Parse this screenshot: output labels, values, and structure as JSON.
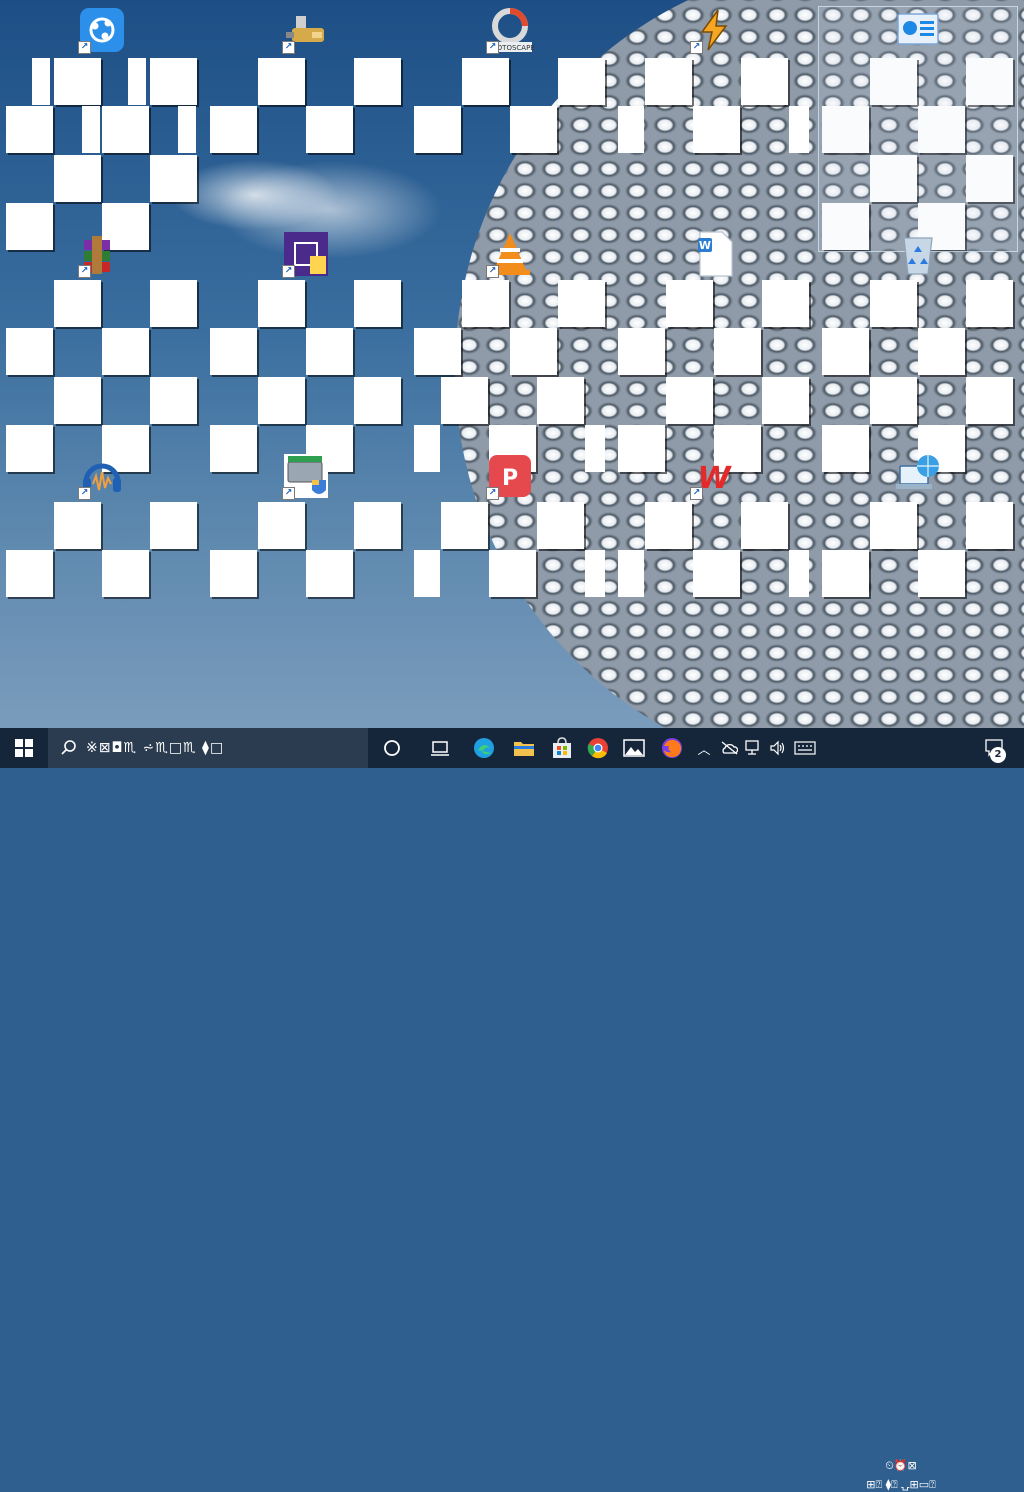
{
  "desktop": {
    "icons": [
      {
        "name": "shareit-icon",
        "color": "#2c8fea"
      },
      {
        "name": "usb-cable-icon",
        "color": "#d6a94a"
      },
      {
        "name": "gotoscape-icon",
        "color": "#e24a2e",
        "label": "GOTOSCAPE"
      },
      {
        "name": "lightning-app-icon",
        "color": "#f5a623"
      },
      {
        "name": "control-panel-icon",
        "color": "#1e88e5"
      },
      {
        "name": "winrar-icon",
        "color": "#7b2fa6"
      },
      {
        "name": "cpu-z-icon",
        "color": "#4a2a8a"
      },
      {
        "name": "vlc-icon",
        "color": "#f28c1a"
      },
      {
        "name": "word-document-icon",
        "color": "#2b7cd3",
        "label": "W"
      },
      {
        "name": "recycle-bin-icon",
        "color": "#c7d7e6"
      },
      {
        "name": "audacity-icon",
        "color": "#1f5fb4"
      },
      {
        "name": "disk-cleanup-icon",
        "color": "#9aa6b2"
      },
      {
        "name": "wps-presentation-icon",
        "color": "#e5484d",
        "label": "P"
      },
      {
        "name": "wps-office-icon",
        "color": "#e4292a",
        "label": "W"
      },
      {
        "name": "network-computer-icon",
        "color": "#3aa0e6"
      }
    ]
  },
  "taskbar": {
    "search_text": "※⊠◘♏  ⩫♏□♏  ⧫□",
    "clock_time": "⏲⏰⊠",
    "clock_date": "⊞⍰ ⧫⍰ ⍽⊞▭⍰",
    "notification_count": "2",
    "pinned": [
      {
        "name": "edge-icon",
        "color": "#1fa0e0"
      },
      {
        "name": "file-explorer-icon",
        "color": "#f2c14e"
      },
      {
        "name": "microsoft-store-icon",
        "color": "#0a84d8"
      },
      {
        "name": "chrome-icon",
        "color": "#e94235"
      },
      {
        "name": "photos-icon",
        "color": "#ffffff"
      },
      {
        "name": "firefox-icon",
        "color": "#ff7a1a"
      }
    ]
  }
}
